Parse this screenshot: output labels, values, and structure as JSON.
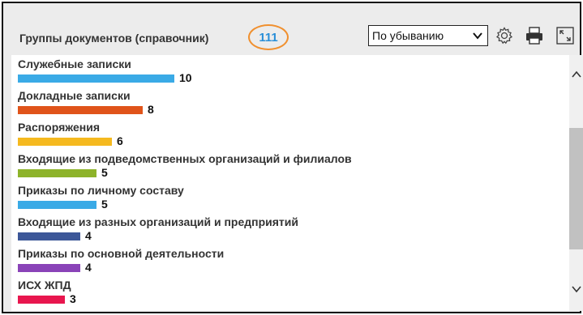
{
  "widget": {
    "title": "Группы документов (справочник)",
    "total": "111",
    "sort_value": "По убыванию"
  },
  "icons": {
    "settings": "gear-icon",
    "print": "printer-icon",
    "expand": "expand-icon",
    "sort_dropdown": "chevron-down-icon",
    "scroll_up": "chevron-up-icon",
    "scroll_down": "chevron-down-icon"
  },
  "chart_data": {
    "type": "bar",
    "orientation": "horizontal",
    "categories": [
      "Служебные записки",
      "Докладные записки",
      "Распоряжения",
      "Входящие из подведомственных организаций и филиалов",
      "Приказы по личному составу",
      "Входящие из разных организаций и предприятий",
      "Приказы по основной деятельности",
      "ИСХ ЖПД"
    ],
    "values": [
      10,
      8,
      6,
      5,
      5,
      4,
      4,
      3
    ],
    "colors": [
      "#3aaae6",
      "#e0541a",
      "#f5b91f",
      "#8db32a",
      "#3aaae6",
      "#3c5798",
      "#8a43b8",
      "#e8164e"
    ]
  }
}
